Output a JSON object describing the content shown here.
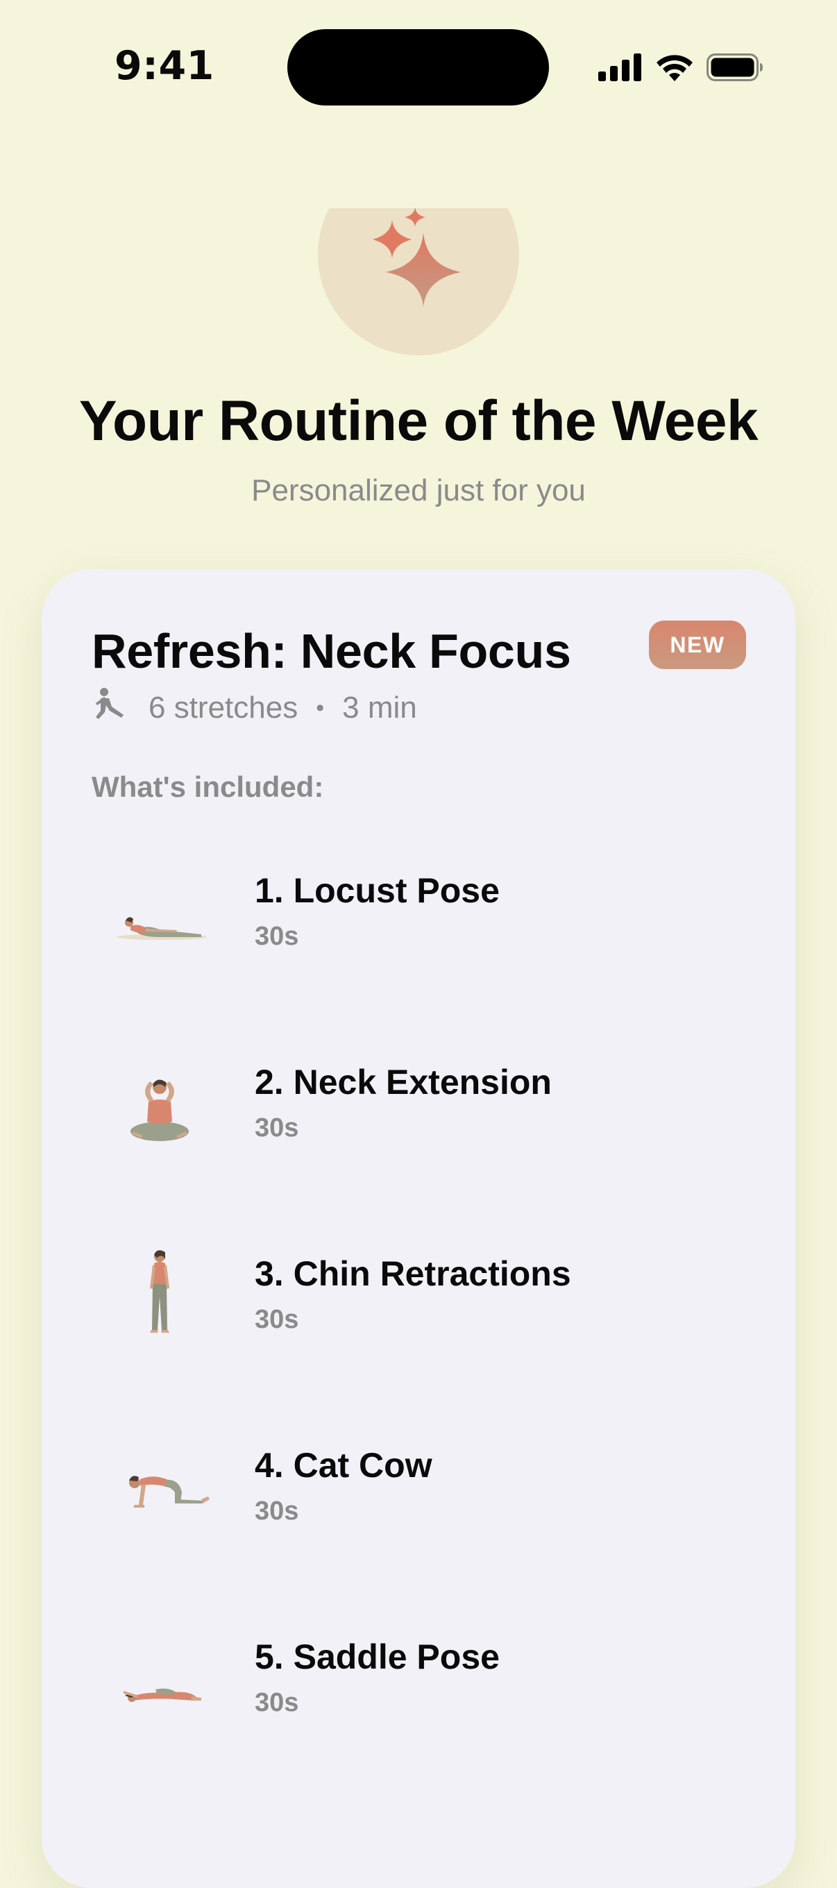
{
  "status_bar": {
    "time": "9:41",
    "icons": [
      "cellular-signal-icon",
      "wifi-icon",
      "battery-icon"
    ]
  },
  "hero": {
    "icon": "sparkles-icon",
    "title": "Your Routine of the Week",
    "subtitle": "Personalized just for you"
  },
  "routine": {
    "title": "Refresh: Neck Focus",
    "badge": "NEW",
    "stretch_icon": "person-stretch-icon",
    "stretches": "6 stretches",
    "separator": "•",
    "duration": "3 min",
    "included_label": "What's included:",
    "exercises": [
      {
        "name": "1. Locust Pose",
        "duration": "30s",
        "pose": "locust"
      },
      {
        "name": "2. Neck Extension",
        "duration": "30s",
        "pose": "neck-extension"
      },
      {
        "name": "3. Chin Retractions",
        "duration": "30s",
        "pose": "standing"
      },
      {
        "name": "4. Cat Cow",
        "duration": "30s",
        "pose": "cat-cow"
      },
      {
        "name": "5. Saddle Pose",
        "duration": "30s",
        "pose": "saddle"
      }
    ]
  },
  "colors": {
    "background": "#f5f5dc",
    "card": "#f2f1f7",
    "accent": "#d9866e",
    "muted_text": "#8a8a8a"
  }
}
